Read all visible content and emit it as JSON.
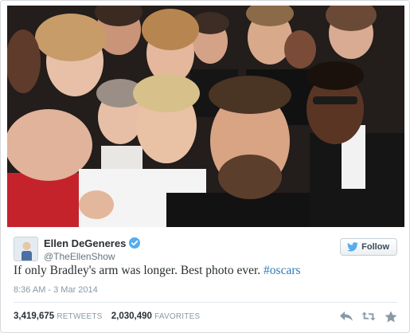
{
  "tweet": {
    "author_name": "Ellen DeGeneres",
    "author_handle": "@TheEllenShow",
    "text_main": "If only Bradley's arm was longer. Best photo ever. ",
    "hashtag": "#oscars",
    "timestamp": "8:36 AM - 3 Mar 2014",
    "retweets_count": "3,419,675",
    "retweets_label": "RETWEETS",
    "favorites_count": "2,030,490",
    "favorites_label": "FAVORITES"
  },
  "follow_button": {
    "label": "Follow"
  },
  "colors": {
    "link": "#2b7bb9",
    "verified": "#55acee",
    "text": "#292f33",
    "muted": "#8899a6"
  },
  "icons": [
    "verified-icon",
    "twitter-bird-icon",
    "reply-icon",
    "retweet-icon",
    "favorite-star-icon"
  ]
}
